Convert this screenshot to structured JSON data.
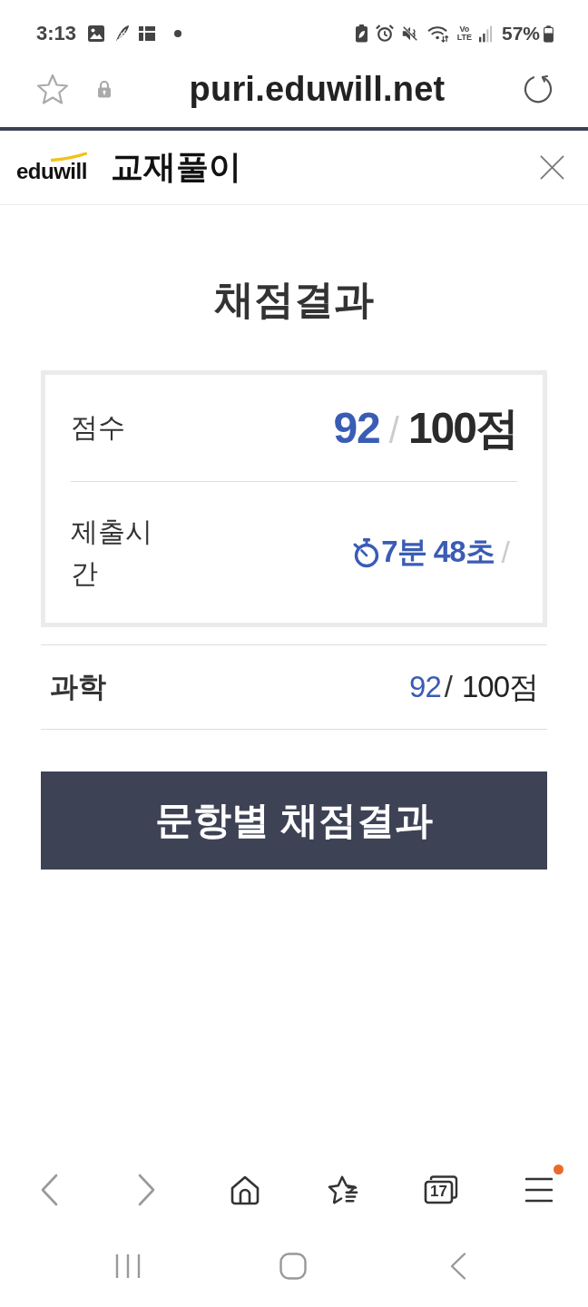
{
  "status_bar": {
    "time": "3:13",
    "network": {
      "top": "Vo",
      "bottom": "LTE"
    },
    "battery": "57%"
  },
  "address_bar": {
    "url": "puri.eduwill.net"
  },
  "site_header": {
    "logo": "eduwill",
    "title": "교재풀이"
  },
  "page": {
    "title": "채점결과"
  },
  "summary": {
    "score": {
      "label": "점수",
      "value": "92",
      "separator": "/",
      "total": "100점"
    },
    "submit_time": {
      "label": "제출시간",
      "value": "7분 48초",
      "separator": "/"
    }
  },
  "subjects": [
    {
      "name": "과학",
      "value": "92",
      "separator": "/",
      "total": "100점"
    }
  ],
  "detail_button": {
    "label": "문항별 채점결과"
  },
  "browser_toolbar": [
    {
      "kind": "back",
      "disabled": true,
      "notification": false
    },
    {
      "kind": "forward",
      "disabled": true,
      "notification": false
    },
    {
      "kind": "home",
      "disabled": false,
      "notification": false
    },
    {
      "kind": "bookmarks",
      "disabled": false,
      "notification": false
    },
    {
      "kind": "tabs",
      "count": "17",
      "disabled": false,
      "notification": false
    },
    {
      "kind": "menu",
      "disabled": false,
      "notification": true
    }
  ],
  "system_nav": [
    {
      "kind": "recents"
    },
    {
      "kind": "home"
    },
    {
      "kind": "back"
    }
  ]
}
